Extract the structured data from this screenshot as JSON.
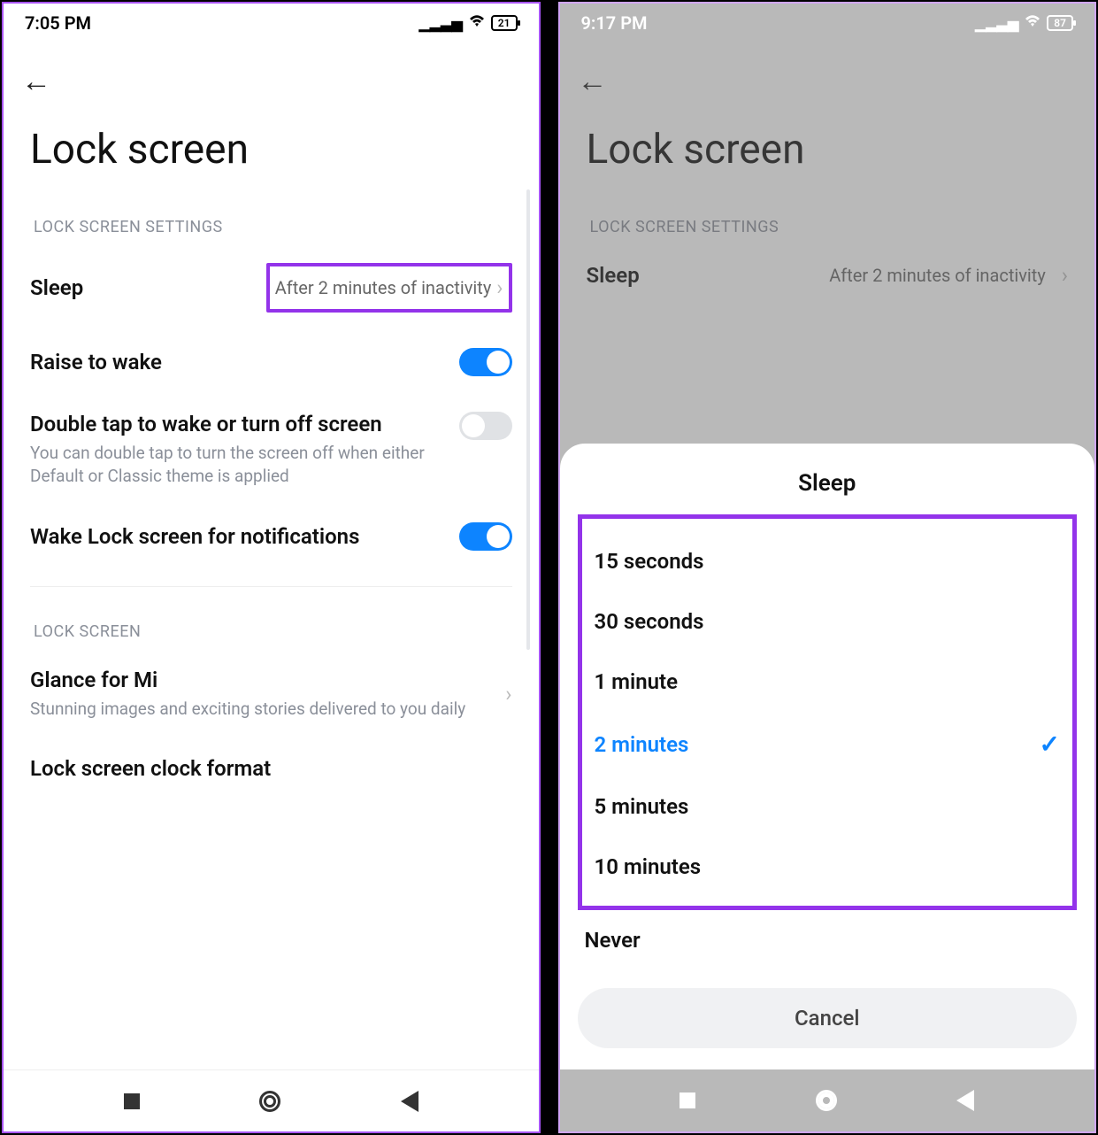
{
  "left": {
    "status_time": "7:05 PM",
    "battery": "21",
    "page_title": "Lock screen",
    "section1": "LOCK SCREEN SETTINGS",
    "sleep": {
      "label": "Sleep",
      "value": "After 2 minutes of inactivity"
    },
    "raise": {
      "label": "Raise to wake"
    },
    "dbltap": {
      "label": "Double tap to wake or turn off screen",
      "sub": "You can double tap to turn the screen off when either Default or Classic theme is applied"
    },
    "wakelock": {
      "label": "Wake Lock screen for notifications"
    },
    "section2": "LOCK SCREEN",
    "glance": {
      "label": "Glance for Mi",
      "sub": "Stunning images and exciting stories delivered to you daily"
    },
    "clockfmt": {
      "label": "Lock screen clock format"
    }
  },
  "right": {
    "status_time": "9:17 PM",
    "battery": "87",
    "page_title": "Lock screen",
    "section1": "LOCK SCREEN SETTINGS",
    "sleep": {
      "label": "Sleep",
      "value": "After 2 minutes of inactivity"
    },
    "sheet": {
      "title": "Sleep",
      "options": [
        "15 seconds",
        "30 seconds",
        "1 minute",
        "2 minutes",
        "5 minutes",
        "10 minutes"
      ],
      "extra": "Never",
      "selected_index": 3,
      "cancel": "Cancel"
    }
  }
}
